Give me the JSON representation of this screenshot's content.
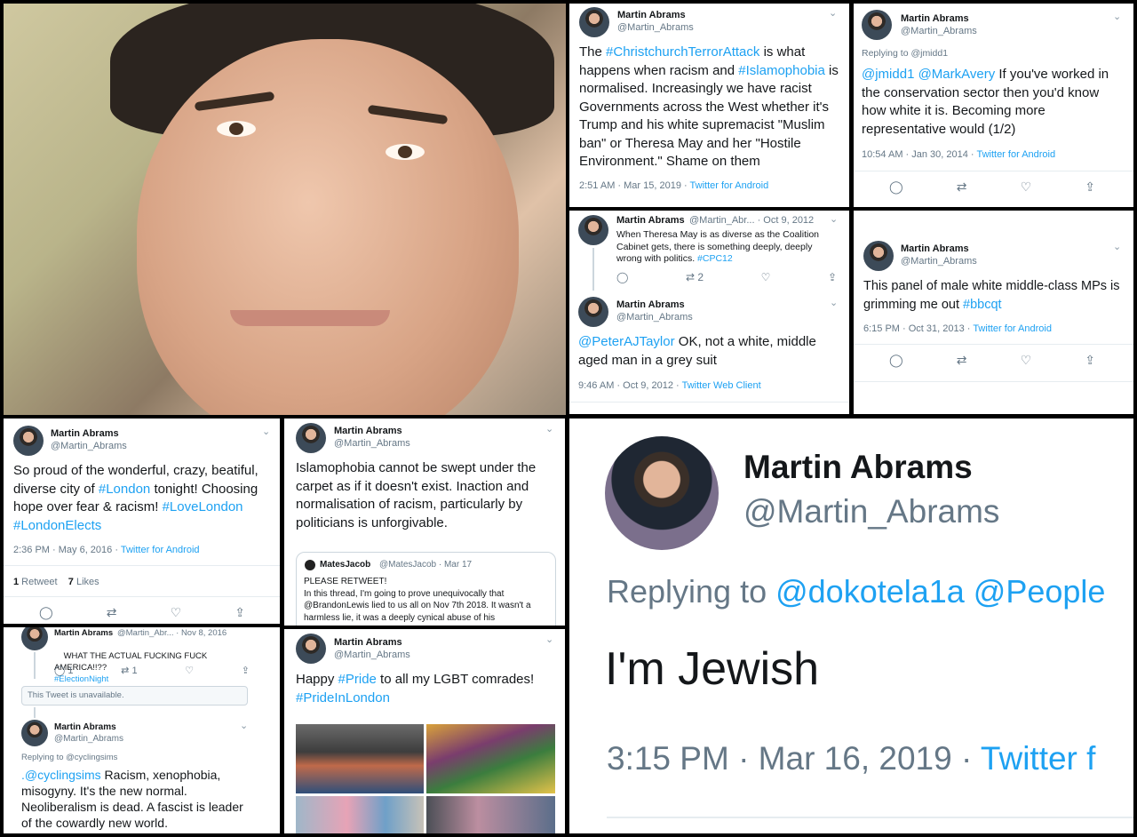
{
  "colors": {
    "link": "#1da1f2",
    "secondary": "#657786",
    "text": "#14171a"
  },
  "icons": {
    "reply": "reply-icon",
    "retweet": "retweet-icon",
    "like": "like-icon",
    "share": "share-icon",
    "chevron": "chevron-down-icon"
  },
  "glyphs": {
    "reply": "◯",
    "retweet": "⇄",
    "like": "♡",
    "share": "⇪",
    "chevron": "⌄"
  },
  "author": {
    "name": "Martin Abrams",
    "handle": "@Martin_Abrams"
  },
  "t1": {
    "segments": [
      "The ",
      "#ChristchurchTerrorAttack",
      " is what happens when racism and ",
      "#Islamophobia",
      " is normalised. Increasingly we have racist Governments across the West whether it's Trump and his white supremacist \"Muslim ban\" or Theresa May and her \"Hostile Environment.\" Shame on them"
    ],
    "time": "2:51 AM · Mar 15, 2019 · ",
    "client": "Twitter for Android"
  },
  "t2": {
    "replying": "Replying to @jmidd1",
    "segments": [
      "@jmidd1 @MarkAvery",
      " If you've worked in the conservation sector then you'd know how white it is. Becoming more representative would (1/2)"
    ],
    "time": "10:54 AM · Jan 30, 2014 · ",
    "client": "Twitter for Android"
  },
  "t3": {
    "handle_date": "@Martin_Abr... · Oct 9, 2012",
    "segments": [
      "When Theresa May is as diverse as the Coalition Cabinet gets, there is something deeply, deeply wrong with politics. ",
      "#CPC12"
    ],
    "retweets": "2",
    "reply_segments": [
      "@PeterAJTaylor",
      " OK, not a white, middle aged man in a grey suit"
    ],
    "time": "9:46 AM · Oct 9, 2012 · ",
    "client": "Twitter Web Client"
  },
  "t4": {
    "segments": [
      "This panel of male white middle-class MPs is grimming me out ",
      "#bbcqt"
    ],
    "time": "6:15 PM · Oct 31, 2013 · ",
    "client": "Twitter for Android"
  },
  "t5": {
    "segments": [
      "So proud of the wonderful, crazy, beatiful, diverse city of ",
      "#London",
      " tonight! Choosing hope over fear & racism! ",
      "#LoveLondon",
      " ",
      "#LondonElects"
    ],
    "time": "2:36 PM · May 6, 2016 · ",
    "client": "Twitter for Android",
    "retweets": "1",
    "retweets_label": " Retweet",
    "likes": "7",
    "likes_label": " Likes"
  },
  "t6": {
    "text": "Islamophobia cannot be swept under the carpet as if it doesn't exist. Inaction and normalisation of racism, particularly by politicians is unforgivable.",
    "quote_name": "MatesJacob",
    "quote_meta": "@MatesJacob · Mar 17",
    "quote_text": "PLEASE RETWEET!\nIn this thread, I'm going to prove unequivocally that @BrandonLewis lied to us all on Nov 7th 2018. It wasn't a harmless lie, it was a deeply cynical abuse of his"
  },
  "t7": {
    "handle_date": "@Martin_Abr... · Nov 8, 2016",
    "top_segments": [
      "WHAT THE ACTUAL FUCKING FUCK AMERICA!!??\n",
      "#ElectionNight"
    ],
    "replies": "1",
    "retweets": "1",
    "unavailable": "This Tweet is unavailable.",
    "replying": "Replying to @cyclingsims",
    "segments": [
      ".@cyclingsims",
      " Racism, xenophobia, misogyny. It's the new normal. Neoliberalism is dead. A fascist is leader of the cowardly new world."
    ]
  },
  "t8": {
    "segments": [
      "Happy ",
      "#Pride",
      " to all my LGBT comrades! ",
      "#PrideInLondon"
    ]
  },
  "t9": {
    "replying_label": "Replying to ",
    "replying_to": "@dokotela1a @People",
    "text": "I'm Jewish",
    "time": "3:15 PM · Mar 16, 2019 · ",
    "client": "Twitter f"
  }
}
